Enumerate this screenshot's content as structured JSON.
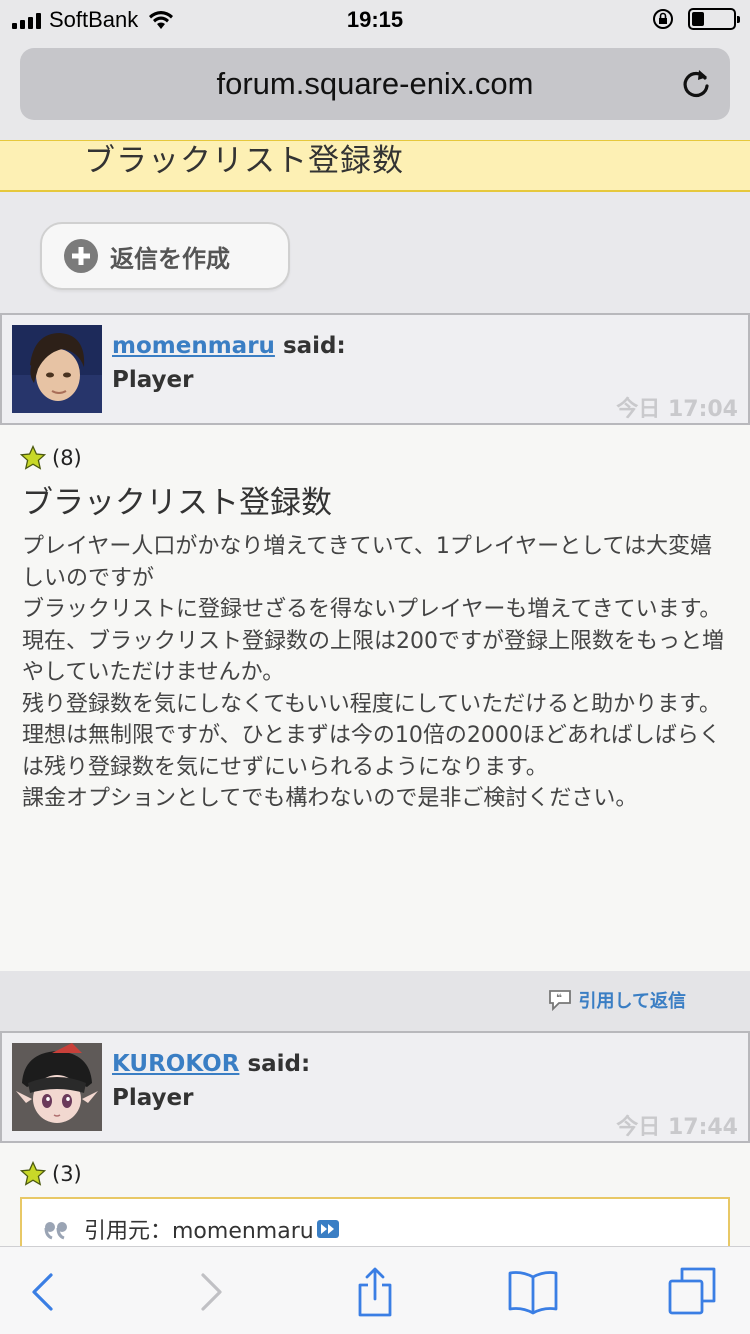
{
  "status_bar": {
    "carrier": "SoftBank",
    "time": "19:15",
    "battery_percent": 30
  },
  "browser": {
    "url": "forum.square-enix.com"
  },
  "thread": {
    "title": "ブラックリスト登録数",
    "reply_button": "返信を作成"
  },
  "posts": [
    {
      "username": "momenmaru",
      "said": "said:",
      "role": "Player",
      "time": "今日 17:04",
      "likes": "(8)",
      "title": "ブラックリスト登録数",
      "lines": [
        "プレイヤー人口がかなり増えてきていて、1プレイヤーとしては大変嬉しいのですが",
        "ブラックリストに登録せざるを得ないプレイヤーも増えてきています。",
        "現在、ブラックリスト登録数の上限は200ですが登録上限数をもっと増やしていただけませんか。",
        "残り登録数を気にしなくてもいい程度にしていただけると助かります。",
        "理想は無制限ですが、ひとまずは今の10倍の2000ほどあればしばらくは残り登録数を気にせずにいられるようになります。",
        "課金オプションとしてでも構わないので是非ご検討ください。"
      ],
      "quote_reply": "引用して返信"
    },
    {
      "username": "KUROKOR",
      "said": "said:",
      "role": "Player",
      "time": "今日 17:44",
      "likes": "(3)",
      "quote_source": "引用元：momenmaru"
    }
  ],
  "icons": {
    "star_color": "#c8d828",
    "link_color": "#3a7ec4",
    "toolbar_color": "#3a7ee4"
  }
}
